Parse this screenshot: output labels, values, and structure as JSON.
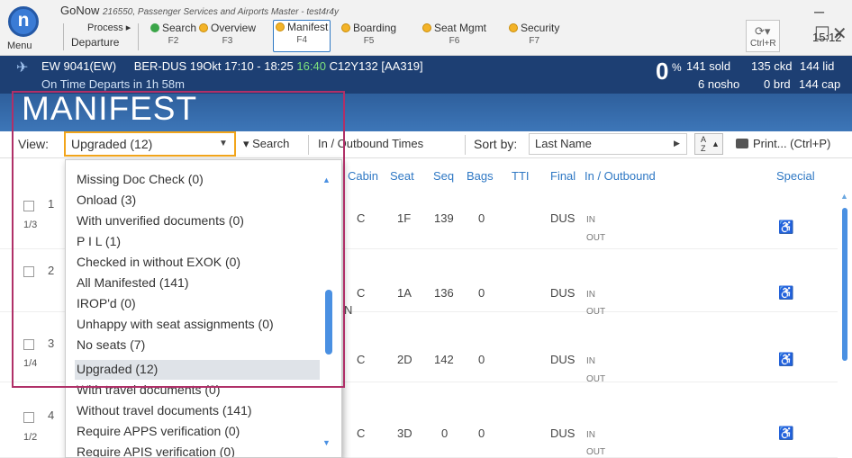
{
  "app": {
    "logo_letter": "n",
    "menu_label": "Menu",
    "title": "GoNow",
    "subtitle": "216550, Passenger Services and Airports Master - test4r4y",
    "process_label": "Process ▸",
    "mode_label": "Departure",
    "nav": [
      {
        "label": "Search",
        "key": "F2",
        "dot": "green"
      },
      {
        "label": "Overview",
        "key": "F3",
        "dot": "yellow"
      },
      {
        "label": "Manifest",
        "key": "F4",
        "dot": "yellow",
        "active": true
      },
      {
        "label": "Boarding",
        "key": "F5",
        "dot": "yellow"
      },
      {
        "label": "Seat Mgmt",
        "key": "F6",
        "dot": "yellow"
      },
      {
        "label": "Security",
        "key": "F7",
        "dot": "yellow"
      }
    ],
    "refresh_key": "Ctrl+R",
    "window_controls": "–☐✕",
    "clock": "15:12"
  },
  "flight": {
    "flight_no": "EW 9041(EW)",
    "route": "BER-DUS",
    "schedule": "19Okt 17:10 - 18:25",
    "estimate": "16:40",
    "config": "C12Y132 [AA319]",
    "status": "On Time",
    "departs_in": "Departs in 1h 58m",
    "percent": "0",
    "percent_sign": "%",
    "sold": "141 sold",
    "noshow": "6 nosho",
    "ckd": "135 ckd",
    "lid": "144 lid",
    "brd": "0 brd",
    "cap": "144 cap"
  },
  "page": {
    "title": "MANIFEST"
  },
  "toolbar": {
    "view_label": "View:",
    "view_value": "Upgraded (12)",
    "search_label": "▾ Search",
    "inout_label": "In / Outbound Times",
    "sortby_label": "Sort by:",
    "sortby_value": "Last Name",
    "az_label_top": "A",
    "az_label_bottom": "Z",
    "print_label": "Print... (Ctrl+P)"
  },
  "columns": {
    "cabin": "Cabin",
    "seat": "Seat",
    "seq": "Seq",
    "bags": "Bags",
    "tti": "TTI",
    "final": "Final",
    "inout": "In / Outbound",
    "special": "Special"
  },
  "rows": [
    {
      "num": "1",
      "frac": "1/3",
      "cabin": "C",
      "seat": "1F",
      "seq": "139",
      "bags": "0",
      "final": "DUS",
      "in": "IN",
      "out": "OUT",
      "extra": ""
    },
    {
      "num": "2",
      "frac": "",
      "cabin": "C",
      "seat": "1A",
      "seq": "136",
      "bags": "0",
      "final": "DUS",
      "in": "IN",
      "out": "OUT",
      "extra": "N"
    },
    {
      "num": "3",
      "frac": "1/4",
      "cabin": "C",
      "seat": "2D",
      "seq": "142",
      "bags": "0",
      "final": "DUS",
      "in": "IN",
      "out": "OUT",
      "extra": ""
    },
    {
      "num": "4",
      "frac": "1/2",
      "cabin": "C",
      "seat": "3D",
      "seq": "0",
      "bags": "0",
      "final": "DUS",
      "in": "IN",
      "out": "OUT",
      "extra": ""
    }
  ],
  "dropdown": {
    "items": [
      "Missing Doc Check (0)",
      "Onload (3)",
      "With unverified documents (0)",
      "P I L (1)",
      "Checked in without EXOK (0)",
      "All Manifested (141)",
      "IROP'd (0)",
      "Unhappy with seat assignments (0)",
      "No seats (7)",
      "Upgraded (12)",
      "With travel documents (0)",
      "Without travel documents (141)",
      "Require APPS verification (0)",
      "Require APIS verification (0)"
    ],
    "selected_index": 9
  },
  "colors": {
    "flightbar": "#1d3f73",
    "manifest_band": "#3d76b8",
    "accent": "#2f78c4",
    "view_focus": "#f2a51b",
    "highlight_box": "#b03068",
    "estimate_green": "#7de07d"
  },
  "icons": {
    "logo": "gonow-logo-icon",
    "plane": "plane-icon",
    "refresh": "refresh-icon",
    "print": "printer-icon",
    "special": "special-assistance-icon"
  }
}
